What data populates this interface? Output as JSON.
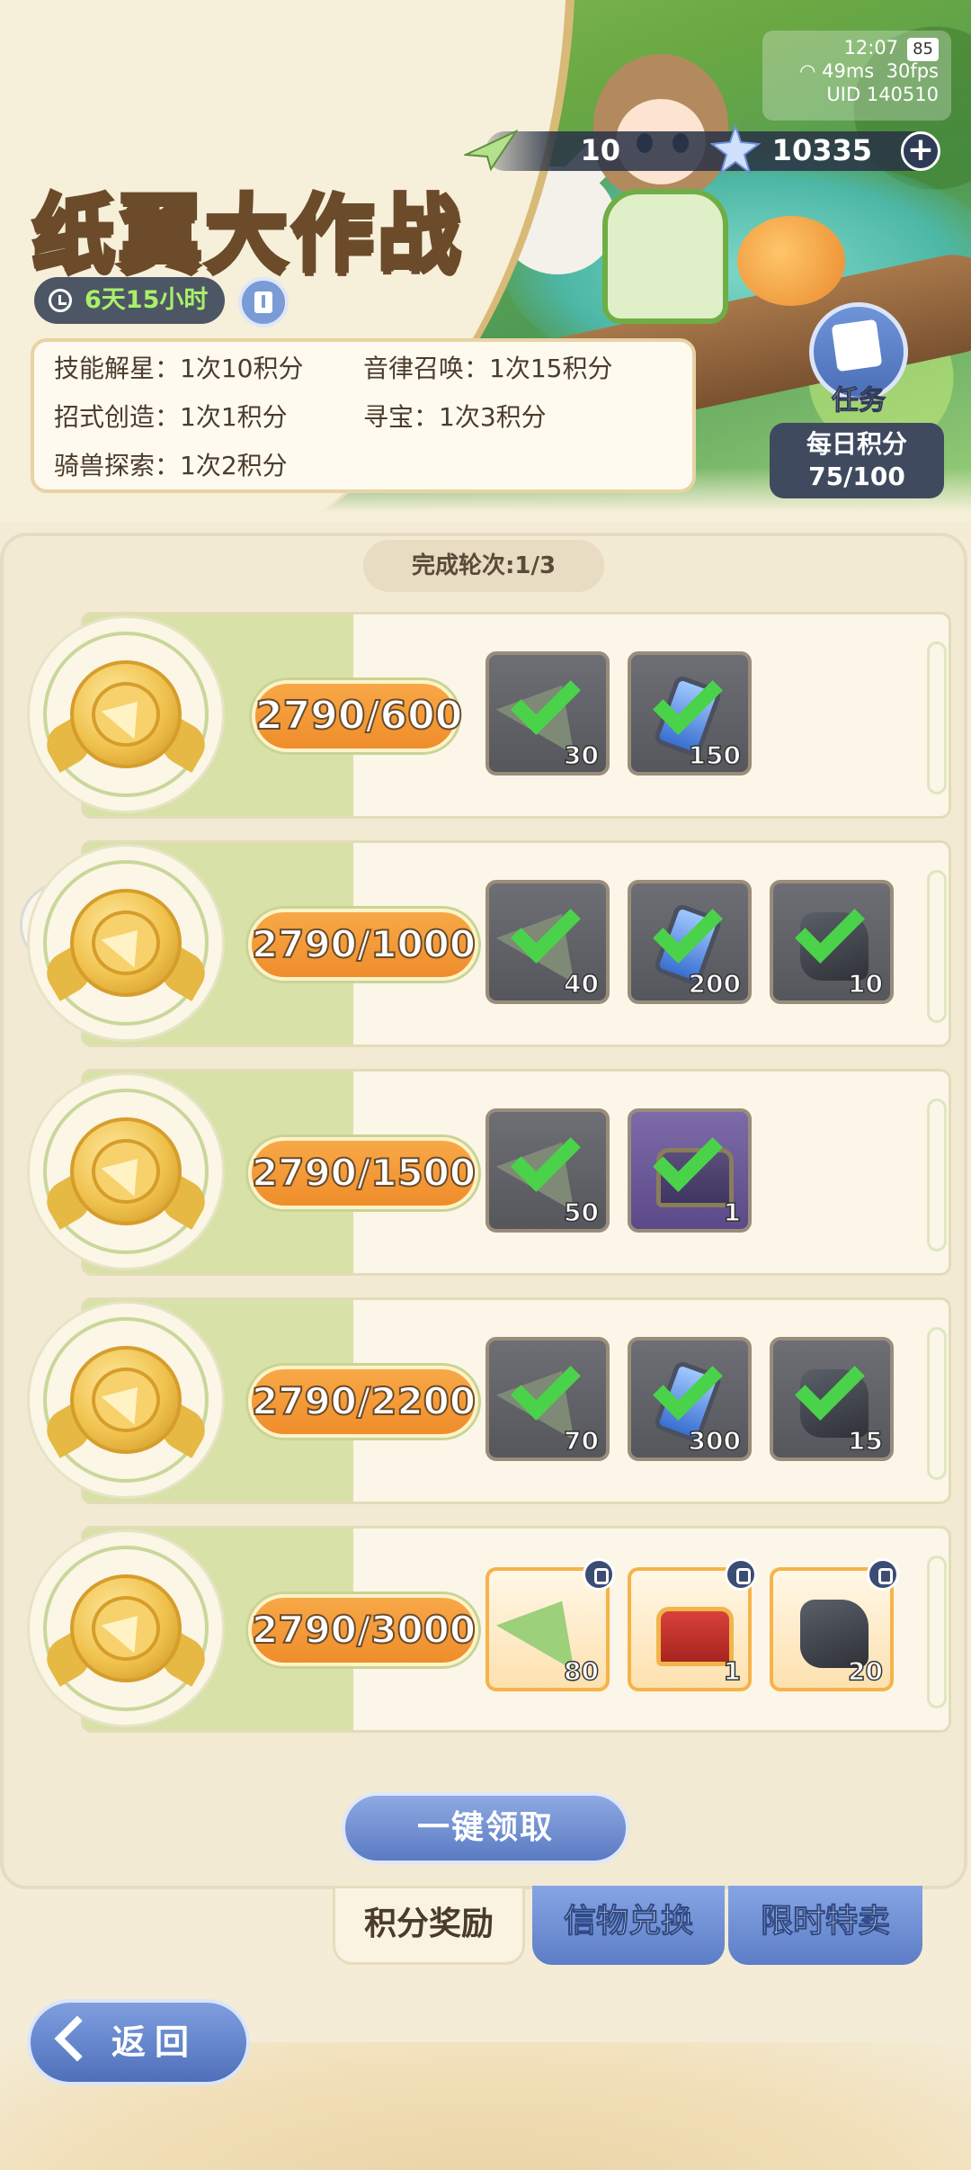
{
  "status": {
    "time": "12:07",
    "battery": "85",
    "ping": "49ms",
    "fps": "30fps",
    "uid": "UID 140510"
  },
  "currency": {
    "planes": "10",
    "stars": "10335",
    "plus": "+"
  },
  "event": {
    "title": "纸翼大作战",
    "timer": "6天15小时"
  },
  "rules": [
    "技能解星：1次10积分",
    "音律召唤：1次15积分",
    "招式创造：1次1积分",
    "寻宝：1次3积分",
    "骑兽探索：1次2积分"
  ],
  "task_button": {
    "label": "任务"
  },
  "daily": {
    "label": "每日积分",
    "value": "75/100"
  },
  "rounds": "完成轮次:1/3",
  "tiers": [
    {
      "progress": "2790/600",
      "items": [
        {
          "icon": "paper-plane-icon",
          "qty": "30",
          "claimed": true
        },
        {
          "icon": "crystal-icon",
          "qty": "150",
          "claimed": true
        }
      ]
    },
    {
      "progress": "2790/1000",
      "items": [
        {
          "icon": "paper-plane-icon",
          "qty": "40",
          "claimed": true
        },
        {
          "icon": "crystal-icon",
          "qty": "200",
          "claimed": true
        },
        {
          "icon": "ore-stone-icon",
          "qty": "10",
          "claimed": true
        }
      ]
    },
    {
      "progress": "2790/1500",
      "items": [
        {
          "icon": "paper-plane-icon",
          "qty": "50",
          "claimed": true
        },
        {
          "icon": "treasure-chest-icon",
          "qty": "1",
          "claimed": true
        }
      ]
    },
    {
      "progress": "2790/2200",
      "items": [
        {
          "icon": "paper-plane-icon",
          "qty": "70",
          "claimed": true
        },
        {
          "icon": "crystal-icon",
          "qty": "300",
          "claimed": true
        },
        {
          "icon": "ore-stone-icon",
          "qty": "15",
          "claimed": true
        }
      ]
    },
    {
      "progress": "2790/3000",
      "items": [
        {
          "icon": "paper-plane-icon",
          "qty": "80",
          "claimed": false
        },
        {
          "icon": "treasure-chest-icon",
          "qty": "1",
          "claimed": false
        },
        {
          "icon": "ore-stone-icon",
          "qty": "20",
          "claimed": false
        }
      ]
    }
  ],
  "claim_all": "一键领取",
  "tabs": [
    "积分奖励",
    "信物兑换",
    "限时特卖"
  ],
  "back": "返回",
  "colors": {
    "accent_orange": "#ef8d2b",
    "button_blue": "#5b7ac2",
    "check_green": "#4bd24b",
    "title_yellow": "#ffd73a",
    "timer_green": "#a8f06a"
  }
}
